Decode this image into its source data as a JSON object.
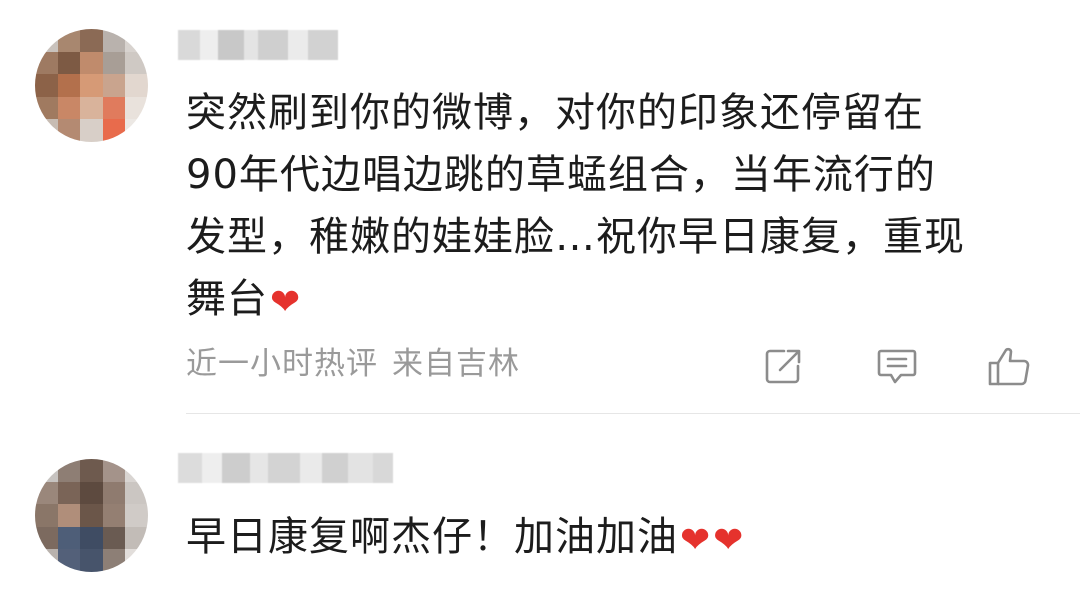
{
  "comments": [
    {
      "text_lines": [
        "突然刷到你的微博，对你的印象还停留在",
        "90年代边唱边跳的草蜢组合，当年流行的",
        "发型，稚嫩的娃娃脸…祝你早日康复，重现",
        "舞台"
      ],
      "emoji": [
        "heart"
      ],
      "meta": {
        "time": "近一小时热评",
        "location": "来自吉林"
      },
      "actions": [
        {
          "icon": "share-icon"
        },
        {
          "icon": "comment-icon"
        },
        {
          "icon": "like-icon"
        }
      ]
    },
    {
      "text_lines": [
        "早日康复啊杰仔！加油加油"
      ],
      "emoji": [
        "heart",
        "heart"
      ]
    }
  ],
  "colors": {
    "text": "#1c1c1c",
    "meta": "#9a9a9a",
    "heart": "#e5322d",
    "divider": "#e6e6e6",
    "icon": "#8c8c8c"
  }
}
